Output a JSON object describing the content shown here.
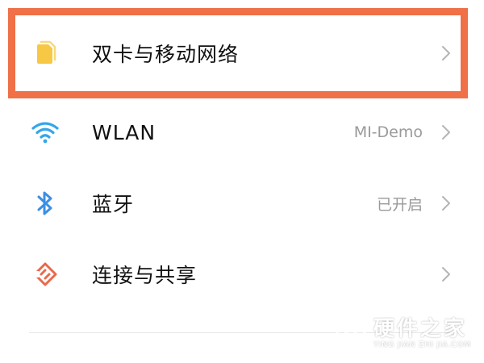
{
  "settings": {
    "items": [
      {
        "label": "双卡与移动网络",
        "value": "",
        "icon": "sim-card-icon",
        "color": "#f7c844"
      },
      {
        "label": "WLAN",
        "value": "MI-Demo",
        "icon": "wifi-icon",
        "color": "#35a6e8"
      },
      {
        "label": "蓝牙",
        "value": "已开启",
        "icon": "bluetooth-icon",
        "color": "#3b8fe6"
      },
      {
        "label": "连接与共享",
        "value": "",
        "icon": "connection-share-icon",
        "color": "#e8694a"
      }
    ]
  },
  "highlight": {
    "color": "#f07048"
  },
  "watermark": {
    "main": "硬件之家",
    "sub": "YING JIAN ZHI JIA.COM"
  }
}
